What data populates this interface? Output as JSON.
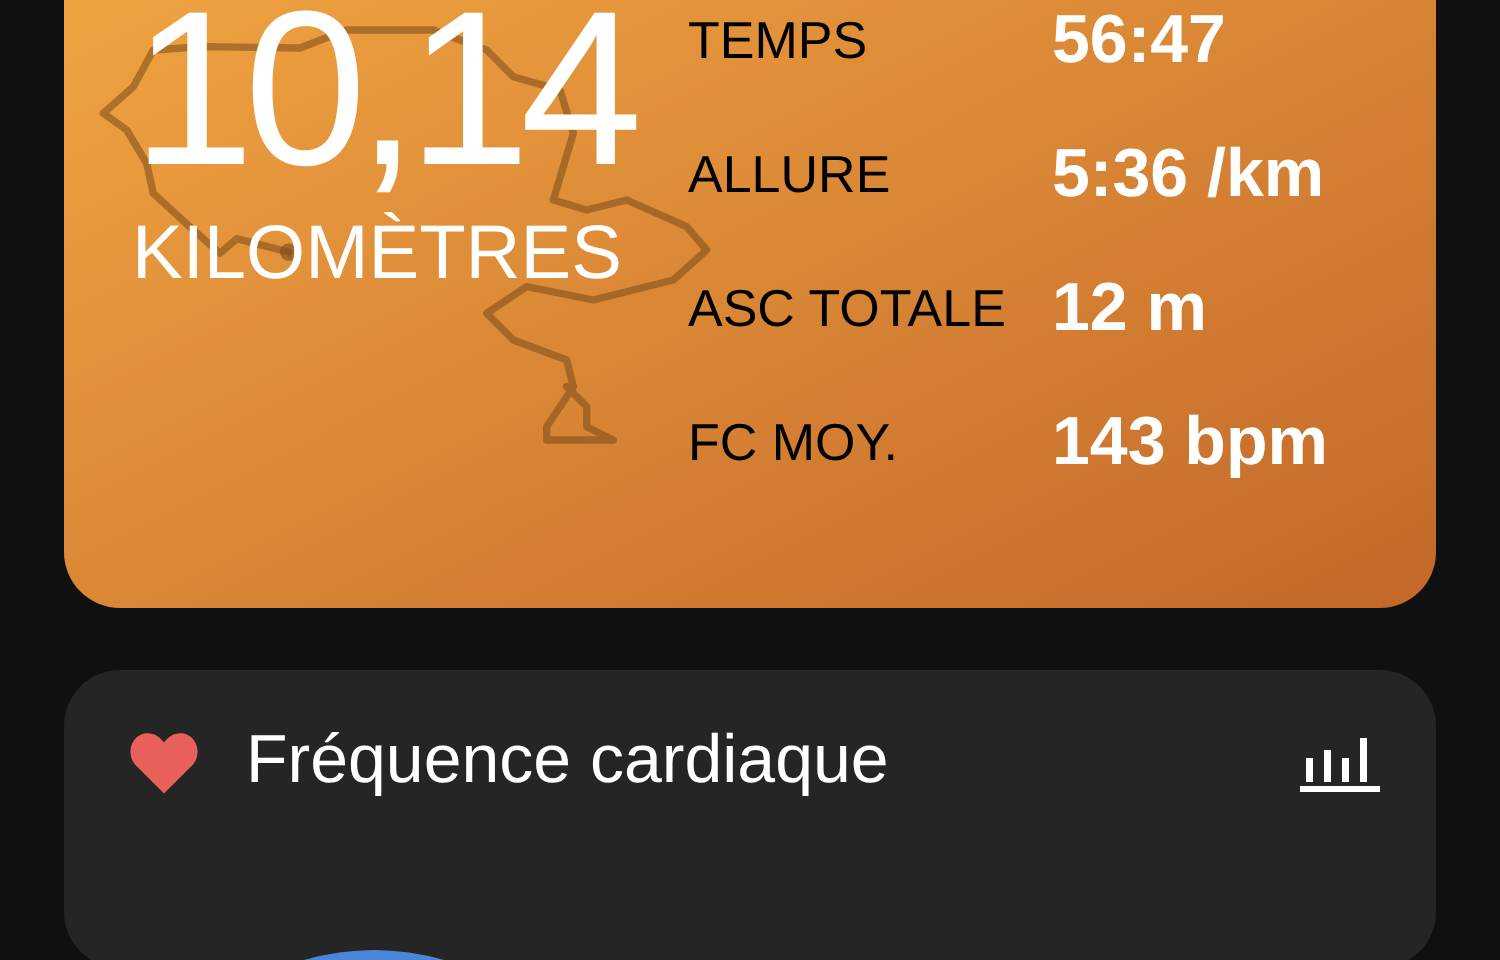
{
  "distance": {
    "value": "10,14",
    "unit": "KILOMÈTRES"
  },
  "stats": [
    {
      "label": "TEMPS",
      "value": "56:47"
    },
    {
      "label": "ALLURE",
      "value": "5:36 /km"
    },
    {
      "label": "ASC TOTALE",
      "value": "12 m"
    },
    {
      "label": "FC MOY.",
      "value": "143 bpm"
    }
  ],
  "heart_rate_card": {
    "title": "Fréquence cardiaque"
  }
}
